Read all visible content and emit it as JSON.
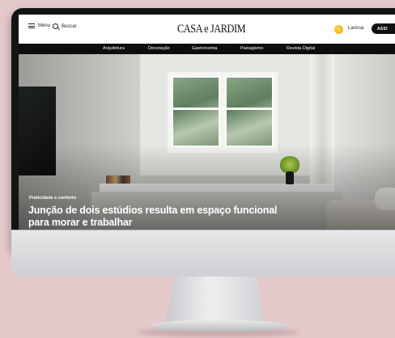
{
  "header": {
    "menu_label": "Menu",
    "search_label": "Buscar",
    "logo_text": "CASA e JARDIM",
    "user_name": "Larissa",
    "cta_label": "ASSI"
  },
  "nav": {
    "items": [
      "Arquitetura",
      "Decoração",
      "Gastronomia",
      "Paisagismo",
      "Revista Digital"
    ]
  },
  "hero": {
    "kicker": "Praticidade e conforto",
    "title": "Junção de dois estúdios resulta em espaço funcional para morar e trabalhar"
  },
  "colors": {
    "background": "#e4c9cb",
    "navbar": "#0d0d0d",
    "avatar": "#f0a816"
  }
}
